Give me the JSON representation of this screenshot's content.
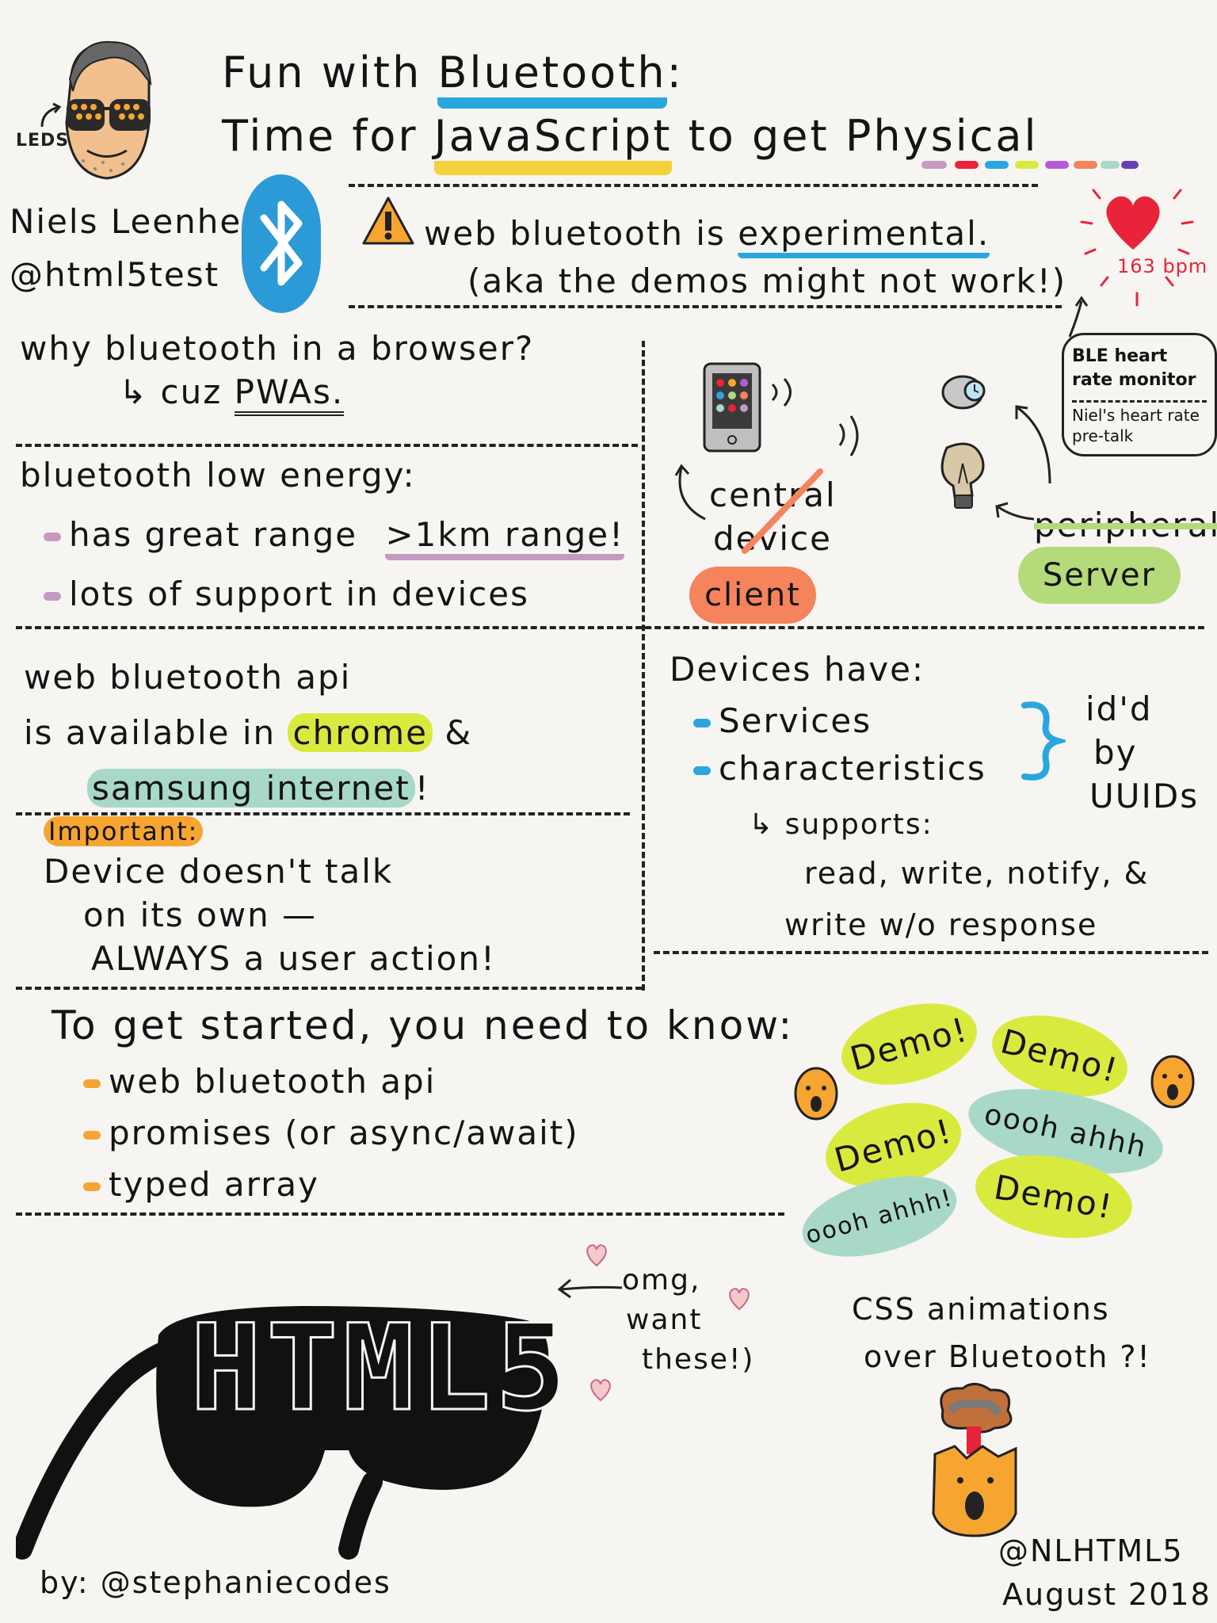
{
  "title": {
    "line1_a": "Fun with",
    "line1_b": "Bluetooth",
    "line1_c": ":",
    "line2_a": "Time for",
    "line2_b": "JavaScript",
    "line2_c": "to get",
    "line2_d": "Physical"
  },
  "avatar_label": "LEDS",
  "speaker": {
    "name": "Niels Leenheer",
    "handle": "@html5test"
  },
  "warning": {
    "line1_a": "web bluetooth is",
    "line1_b": "experimental.",
    "line2": "(aka the demos might not work!)"
  },
  "heart": {
    "bpm": "163 bpm"
  },
  "heart_notes": {
    "monitor": "BLE heart rate monitor",
    "pretalk": "Niel's heart rate pre-talk"
  },
  "why": {
    "question": "why bluetooth in a browser?",
    "answer_prefix": "↳ cuz",
    "answer": "PWAs."
  },
  "ble": {
    "heading": "bluetooth low energy:",
    "item1_a": "has great range",
    "item1_b": ">1km range!",
    "item2": "lots of support in devices"
  },
  "roles": {
    "central": "central",
    "device": "device",
    "client": "client",
    "peripheral": "peripheral",
    "server": "Server"
  },
  "api": {
    "line1": "web bluetooth api",
    "line2_a": "is available in",
    "line2_b": "chrome",
    "line2_c": "&",
    "line3": "samsung internet",
    "line3_end": "!"
  },
  "important": {
    "label": "Important:",
    "line1": "Device doesn't talk",
    "line2": "on its own —",
    "line3": "ALWAYS a user action!"
  },
  "devices": {
    "heading": "Devices have:",
    "item1": "Services",
    "item2": "characteristics",
    "idd": [
      "id'd",
      "by",
      "UUIDs"
    ],
    "supports": "↳ supports:",
    "ops1": "read, write, notify, &",
    "ops2": "write w/o response"
  },
  "started": {
    "heading": "To get started, you need to know:",
    "items": [
      "web bluetooth api",
      "promises (or async/await)",
      "typed array"
    ]
  },
  "demos": {
    "d1": "Demo!",
    "d2": "Demo!",
    "d3": "Demo!",
    "d4": "Demo!",
    "ooh1": "oooh ahhh",
    "ooh2": "oooh ahhh!"
  },
  "glasses": {
    "text": "HTML5"
  },
  "omg": {
    "line1": "omg,",
    "line2": "want",
    "line3": "these!)"
  },
  "css": {
    "line1": "CSS animations",
    "line2": "over Bluetooth ?!"
  },
  "footer": {
    "by": "by: @stephaniecodes",
    "account": "@NLHTML5",
    "date": "August 2018"
  },
  "colors": {
    "blue": "#2aa6df",
    "yellow": "#f4d13c",
    "purple": "#c49ac0",
    "lime": "#d9ea3f",
    "teal": "#a8d8c8",
    "orange": "#f7a531",
    "salmon": "#f5835c",
    "green": "#b4da7a",
    "red": "#e8233a",
    "bt_blue": "#2c9ad6"
  }
}
